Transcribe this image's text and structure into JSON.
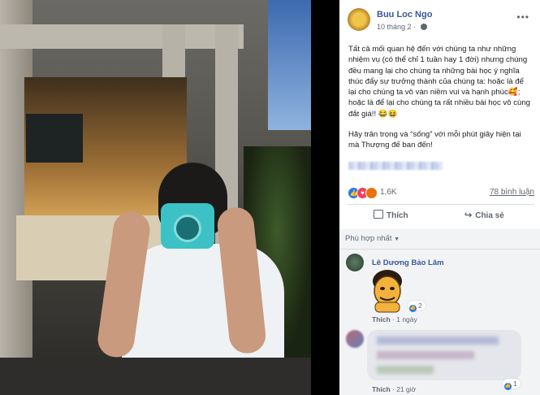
{
  "post": {
    "author": "Buu Loc Ngo",
    "date": "10 tháng 2",
    "separator": "·",
    "paragraphs": [
      "Tất cả mối quan hệ đến với chúng ta như những nhiệm vụ (có thể chỉ 1 tuần hay 1 đời) nhưng chúng đều mang lại cho chúng ta những bài học ý nghĩa thúc đẩy sự trưởng thành của chúng ta: hoặc là để lại cho chúng ta vô vàn niềm vui và hạnh phúc🥰; hoặc là để lại cho chúng ta rất nhiều bài học vô cùng đắt giá!! 😂😆",
      "Hãy trân trọng và “sống” với mỗi phút giây hiện tại mà Thượng đế ban đến!"
    ],
    "reaction_count": "1,6K",
    "comment_count": "78 bình luận",
    "like_label": "Thích",
    "share_label": "Chia sẻ"
  },
  "comments": {
    "sort_label": "Phù hợp nhất",
    "items": [
      {
        "name": "Lê Dương Bảo Lâm",
        "reaction_count": "2",
        "like_label": "Thích",
        "time": "1 ngày"
      },
      {
        "reaction_count": "1",
        "like_label": "Thích",
        "time": "21 giờ"
      }
    ]
  },
  "colors": {
    "link": "#385898",
    "like_blue": "#2078f4",
    "love_red": "#f33e58",
    "angry": "#e9710f"
  },
  "icons": [
    "globe-icon",
    "more-icon",
    "like-reaction-icon",
    "love-reaction-icon",
    "angry-reaction-icon",
    "thumbs-up-icon",
    "share-icon",
    "caret-down-icon"
  ]
}
